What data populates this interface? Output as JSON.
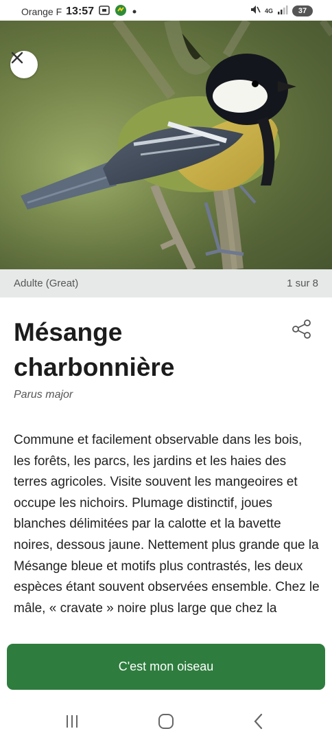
{
  "status_bar": {
    "carrier": "Orange F",
    "time": "13:57",
    "network": "4G",
    "battery": "37",
    "icons": [
      "screenshot-icon",
      "app-notification-icon",
      "dot-icon",
      "mute-icon",
      "signal-icon"
    ]
  },
  "hero": {
    "image_description_icon": "great-tit-bird-photo",
    "close_icon": "close-icon"
  },
  "caption": {
    "label": "Adulte (Great)",
    "counter": "1 sur 8"
  },
  "species": {
    "common_name": "Mésange charbonnière",
    "latin_name": "Parus major",
    "share_icon": "share-icon",
    "description": "Commune et facilement observable dans les bois, les forêts, les parcs, les jardins et les haies des terres agricoles. Visite souvent les mangeoires et occupe les nichoirs. Plumage distinctif, joues blanches délimitées par la calotte et la bavette noires, dessous jaune. Nettement plus grande que la Mésange bleue et motifs plus contrastés, les deux espèces étant souvent observées ensemble. Chez le mâle, « cravate » noire plus large que chez la"
  },
  "actions": {
    "primary_label": "C'est mon oiseau",
    "primary_color": "#2e7d3e"
  },
  "nav": {
    "icons": [
      "recent-apps-icon",
      "home-icon",
      "back-icon"
    ]
  }
}
